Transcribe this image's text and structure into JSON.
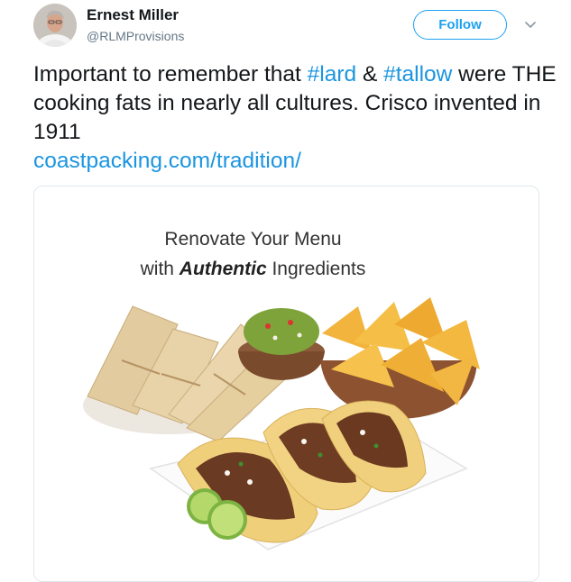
{
  "author": {
    "name": "Ernest Miller",
    "handle": "@RLMProvisions"
  },
  "follow_label": "Follow",
  "tweet": {
    "t1": "Important to remember that ",
    "hashtag1": "#lard",
    "t2": " & ",
    "hashtag2": "#tallow",
    "t3": " were THE cooking fats in nearly all cultures. Crisco invented in 1911",
    "link": "coastpacking.com/tradition/"
  },
  "card": {
    "line1": "Renovate Your Menu",
    "line2_prefix": "with ",
    "line2_emphasis": "Authentic",
    "line2_suffix": " Ingredients"
  },
  "colors": {
    "link": "#1b95e0",
    "follow": "#1da1f2",
    "handle": "#657786"
  },
  "icons": [
    "avatar-photo",
    "chevron-down-icon"
  ]
}
